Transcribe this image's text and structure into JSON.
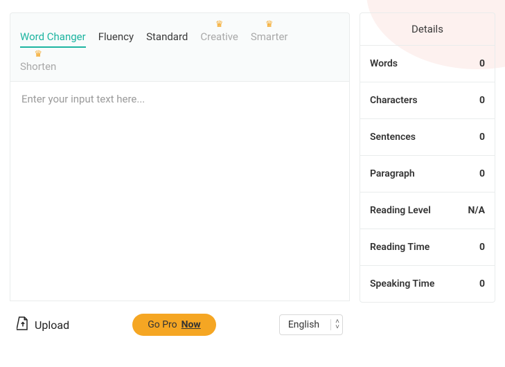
{
  "tabs": {
    "word_changer": "Word Changer",
    "fluency": "Fluency",
    "standard": "Standard",
    "creative": "Creative",
    "smarter": "Smarter",
    "shorten": "Shorten"
  },
  "editor": {
    "placeholder": "Enter your input text here..."
  },
  "bottom": {
    "upload": "Upload",
    "go_pro": "Go Pro",
    "now": "Now",
    "language": "English"
  },
  "details": {
    "header": "Details",
    "stats": [
      {
        "label": "Words",
        "value": "0"
      },
      {
        "label": "Characters",
        "value": "0"
      },
      {
        "label": "Sentences",
        "value": "0"
      },
      {
        "label": "Paragraph",
        "value": "0"
      },
      {
        "label": "Reading Level",
        "value": "N/A"
      },
      {
        "label": "Reading Time",
        "value": "0"
      },
      {
        "label": "Speaking Time",
        "value": "0"
      }
    ]
  }
}
